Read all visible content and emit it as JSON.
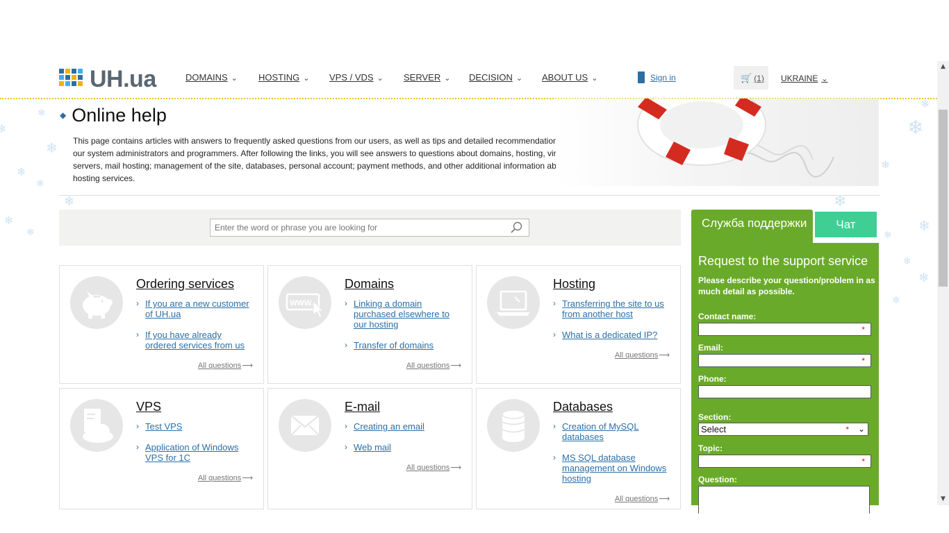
{
  "header": {
    "logo_text": "UH.ua",
    "nav": [
      {
        "label": "DOMAINS"
      },
      {
        "label": "HOSTING"
      },
      {
        "label": "VPS / VDS"
      },
      {
        "label": "SERVER"
      },
      {
        "label": "DECISION"
      },
      {
        "label": "ABOUT US"
      }
    ],
    "sign_in": "Sign in",
    "cart_count": "(1)",
    "country": "UKRAINE"
  },
  "intro": {
    "title": "Online help",
    "text": "This page contains articles with answers to frequently asked questions from our users, as well as tips and detailed recommendations from our system administrators and programmers. After following the links, you will see answers to questions about domains, hosting, virtual servers, mail hosting; management of the site, databases, personal account; payment methods, and other additional information about our hosting services."
  },
  "search": {
    "placeholder": "Enter the word or phrase you are looking for"
  },
  "cards": [
    {
      "title": "Ordering services",
      "icon": "piggy-bank-icon",
      "links": [
        "If you are a new customer of UH.ua",
        "If you have already ordered services from us"
      ],
      "all": "All questions"
    },
    {
      "title": "Domains",
      "icon": "www-cursor-icon",
      "links": [
        "Linking a domain purchased elsewhere to our hosting",
        "Transfer of domains"
      ],
      "all": "All questions"
    },
    {
      "title": "Hosting",
      "icon": "laptop-icon",
      "links": [
        "Transferring the site to us from another host",
        "What is a dedicated IP?"
      ],
      "all": "All questions"
    },
    {
      "title": "VPS",
      "icon": "server-cloud-icon",
      "links": [
        "Test VPS",
        "Application of Windows VPS for 1C"
      ],
      "all": "All questions"
    },
    {
      "title": "E-mail",
      "icon": "envelope-icon",
      "links": [
        "Creating an email",
        "Web mail"
      ],
      "all": "All questions"
    },
    {
      "title": "Databases",
      "icon": "database-icon",
      "links": [
        "Creation of MySQL databases",
        "MS SQL database management on Windows hosting"
      ],
      "all": "All questions"
    }
  ],
  "support": {
    "tab_support": "Служба поддержки",
    "tab_chat": "Чат",
    "title": "Request to the support service",
    "description": "Please describe your question/problem in as much detail as possible.",
    "labels": {
      "contact": "Contact name:",
      "email": "Email:",
      "phone": "Phone:",
      "section": "Section:",
      "topic": "Topic:",
      "question": "Question:"
    },
    "section_value": "Select",
    "required_mark": "*"
  },
  "colors": {
    "support_green": "#6aaa2a",
    "chat_teal": "#3fcf94",
    "link_blue": "#2a6fa8",
    "logo_gray": "#5a6672"
  }
}
